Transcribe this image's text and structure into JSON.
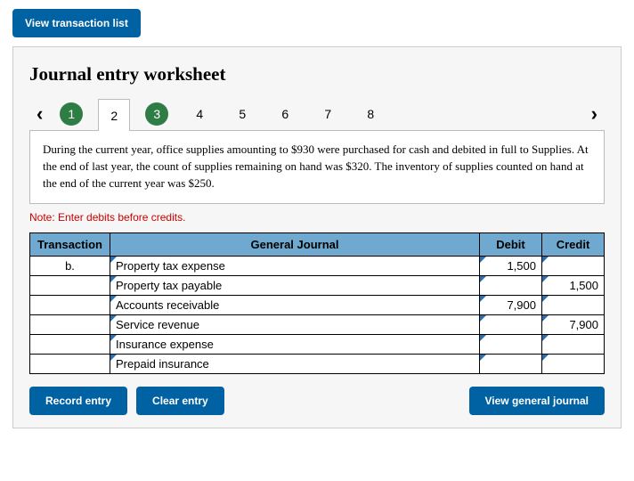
{
  "viewTransactionList": "View transaction list",
  "title": "Journal entry worksheet",
  "tabs": [
    "1",
    "2",
    "3",
    "4",
    "5",
    "6",
    "7",
    "8"
  ],
  "description": "During the current year, office supplies amounting to $930 were purchased for cash and debited in full to Supplies. At the end of last year, the count of supplies remaining on hand was $320. The inventory of supplies counted on hand at the end of the current year was $250.",
  "note": "Note: Enter debits before credits.",
  "headers": {
    "transaction": "Transaction",
    "journal": "General Journal",
    "debit": "Debit",
    "credit": "Credit"
  },
  "rows": [
    {
      "txn": "b.",
      "account": "Property tax expense",
      "debit": "1,500",
      "credit": "",
      "indent": false
    },
    {
      "txn": "",
      "account": "Property tax payable",
      "debit": "",
      "credit": "1,500",
      "indent": true
    },
    {
      "txn": "",
      "account": "Accounts receivable",
      "debit": "7,900",
      "credit": "",
      "indent": false
    },
    {
      "txn": "",
      "account": "Service revenue",
      "debit": "",
      "credit": "7,900",
      "indent": true
    },
    {
      "txn": "",
      "account": "Insurance expense",
      "debit": "",
      "credit": "",
      "indent": false
    },
    {
      "txn": "",
      "account": "Prepaid insurance",
      "debit": "",
      "credit": "",
      "indent": true
    }
  ],
  "buttons": {
    "record": "Record entry",
    "clear": "Clear entry",
    "viewJournal": "View general journal"
  }
}
